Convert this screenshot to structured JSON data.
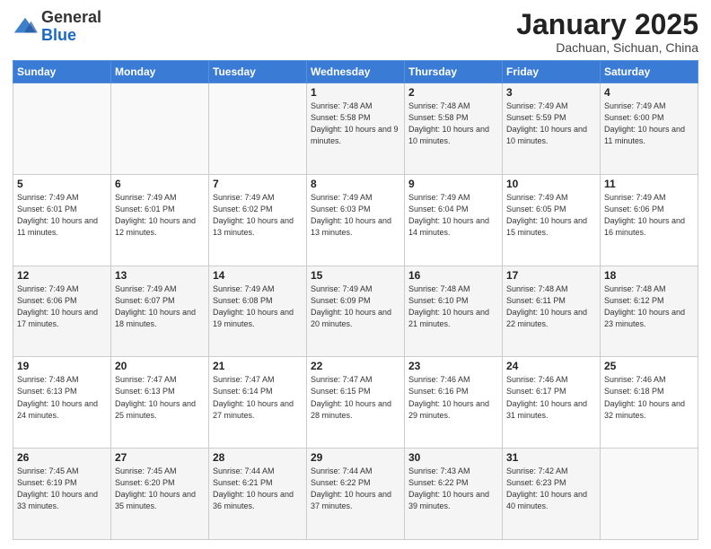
{
  "logo": {
    "general": "General",
    "blue": "Blue"
  },
  "header": {
    "month": "January 2025",
    "location": "Dachuan, Sichuan, China"
  },
  "days_of_week": [
    "Sunday",
    "Monday",
    "Tuesday",
    "Wednesday",
    "Thursday",
    "Friday",
    "Saturday"
  ],
  "weeks": [
    [
      {
        "day": "",
        "sunrise": "",
        "sunset": "",
        "daylight": ""
      },
      {
        "day": "",
        "sunrise": "",
        "sunset": "",
        "daylight": ""
      },
      {
        "day": "",
        "sunrise": "",
        "sunset": "",
        "daylight": ""
      },
      {
        "day": "1",
        "sunrise": "Sunrise: 7:48 AM",
        "sunset": "Sunset: 5:58 PM",
        "daylight": "Daylight: 10 hours and 9 minutes."
      },
      {
        "day": "2",
        "sunrise": "Sunrise: 7:48 AM",
        "sunset": "Sunset: 5:58 PM",
        "daylight": "Daylight: 10 hours and 10 minutes."
      },
      {
        "day": "3",
        "sunrise": "Sunrise: 7:49 AM",
        "sunset": "Sunset: 5:59 PM",
        "daylight": "Daylight: 10 hours and 10 minutes."
      },
      {
        "day": "4",
        "sunrise": "Sunrise: 7:49 AM",
        "sunset": "Sunset: 6:00 PM",
        "daylight": "Daylight: 10 hours and 11 minutes."
      }
    ],
    [
      {
        "day": "5",
        "sunrise": "Sunrise: 7:49 AM",
        "sunset": "Sunset: 6:01 PM",
        "daylight": "Daylight: 10 hours and 11 minutes."
      },
      {
        "day": "6",
        "sunrise": "Sunrise: 7:49 AM",
        "sunset": "Sunset: 6:01 PM",
        "daylight": "Daylight: 10 hours and 12 minutes."
      },
      {
        "day": "7",
        "sunrise": "Sunrise: 7:49 AM",
        "sunset": "Sunset: 6:02 PM",
        "daylight": "Daylight: 10 hours and 13 minutes."
      },
      {
        "day": "8",
        "sunrise": "Sunrise: 7:49 AM",
        "sunset": "Sunset: 6:03 PM",
        "daylight": "Daylight: 10 hours and 13 minutes."
      },
      {
        "day": "9",
        "sunrise": "Sunrise: 7:49 AM",
        "sunset": "Sunset: 6:04 PM",
        "daylight": "Daylight: 10 hours and 14 minutes."
      },
      {
        "day": "10",
        "sunrise": "Sunrise: 7:49 AM",
        "sunset": "Sunset: 6:05 PM",
        "daylight": "Daylight: 10 hours and 15 minutes."
      },
      {
        "day": "11",
        "sunrise": "Sunrise: 7:49 AM",
        "sunset": "Sunset: 6:06 PM",
        "daylight": "Daylight: 10 hours and 16 minutes."
      }
    ],
    [
      {
        "day": "12",
        "sunrise": "Sunrise: 7:49 AM",
        "sunset": "Sunset: 6:06 PM",
        "daylight": "Daylight: 10 hours and 17 minutes."
      },
      {
        "day": "13",
        "sunrise": "Sunrise: 7:49 AM",
        "sunset": "Sunset: 6:07 PM",
        "daylight": "Daylight: 10 hours and 18 minutes."
      },
      {
        "day": "14",
        "sunrise": "Sunrise: 7:49 AM",
        "sunset": "Sunset: 6:08 PM",
        "daylight": "Daylight: 10 hours and 19 minutes."
      },
      {
        "day": "15",
        "sunrise": "Sunrise: 7:49 AM",
        "sunset": "Sunset: 6:09 PM",
        "daylight": "Daylight: 10 hours and 20 minutes."
      },
      {
        "day": "16",
        "sunrise": "Sunrise: 7:48 AM",
        "sunset": "Sunset: 6:10 PM",
        "daylight": "Daylight: 10 hours and 21 minutes."
      },
      {
        "day": "17",
        "sunrise": "Sunrise: 7:48 AM",
        "sunset": "Sunset: 6:11 PM",
        "daylight": "Daylight: 10 hours and 22 minutes."
      },
      {
        "day": "18",
        "sunrise": "Sunrise: 7:48 AM",
        "sunset": "Sunset: 6:12 PM",
        "daylight": "Daylight: 10 hours and 23 minutes."
      }
    ],
    [
      {
        "day": "19",
        "sunrise": "Sunrise: 7:48 AM",
        "sunset": "Sunset: 6:13 PM",
        "daylight": "Daylight: 10 hours and 24 minutes."
      },
      {
        "day": "20",
        "sunrise": "Sunrise: 7:47 AM",
        "sunset": "Sunset: 6:13 PM",
        "daylight": "Daylight: 10 hours and 25 minutes."
      },
      {
        "day": "21",
        "sunrise": "Sunrise: 7:47 AM",
        "sunset": "Sunset: 6:14 PM",
        "daylight": "Daylight: 10 hours and 27 minutes."
      },
      {
        "day": "22",
        "sunrise": "Sunrise: 7:47 AM",
        "sunset": "Sunset: 6:15 PM",
        "daylight": "Daylight: 10 hours and 28 minutes."
      },
      {
        "day": "23",
        "sunrise": "Sunrise: 7:46 AM",
        "sunset": "Sunset: 6:16 PM",
        "daylight": "Daylight: 10 hours and 29 minutes."
      },
      {
        "day": "24",
        "sunrise": "Sunrise: 7:46 AM",
        "sunset": "Sunset: 6:17 PM",
        "daylight": "Daylight: 10 hours and 31 minutes."
      },
      {
        "day": "25",
        "sunrise": "Sunrise: 7:46 AM",
        "sunset": "Sunset: 6:18 PM",
        "daylight": "Daylight: 10 hours and 32 minutes."
      }
    ],
    [
      {
        "day": "26",
        "sunrise": "Sunrise: 7:45 AM",
        "sunset": "Sunset: 6:19 PM",
        "daylight": "Daylight: 10 hours and 33 minutes."
      },
      {
        "day": "27",
        "sunrise": "Sunrise: 7:45 AM",
        "sunset": "Sunset: 6:20 PM",
        "daylight": "Daylight: 10 hours and 35 minutes."
      },
      {
        "day": "28",
        "sunrise": "Sunrise: 7:44 AM",
        "sunset": "Sunset: 6:21 PM",
        "daylight": "Daylight: 10 hours and 36 minutes."
      },
      {
        "day": "29",
        "sunrise": "Sunrise: 7:44 AM",
        "sunset": "Sunset: 6:22 PM",
        "daylight": "Daylight: 10 hours and 37 minutes."
      },
      {
        "day": "30",
        "sunrise": "Sunrise: 7:43 AM",
        "sunset": "Sunset: 6:22 PM",
        "daylight": "Daylight: 10 hours and 39 minutes."
      },
      {
        "day": "31",
        "sunrise": "Sunrise: 7:42 AM",
        "sunset": "Sunset: 6:23 PM",
        "daylight": "Daylight: 10 hours and 40 minutes."
      },
      {
        "day": "",
        "sunrise": "",
        "sunset": "",
        "daylight": ""
      }
    ]
  ]
}
